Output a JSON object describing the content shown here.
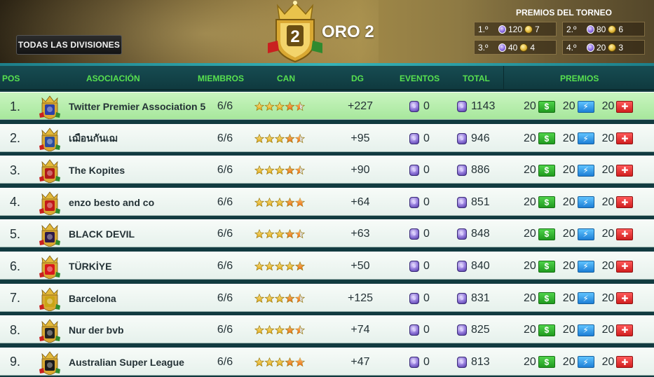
{
  "header": {
    "all_divisions_button": "TODAS LAS DIVISIONES",
    "division_badge_number": "2",
    "division_title": "ORO 2",
    "prizes_title": "PREMIOS DEL TORNEO",
    "prizes": [
      {
        "place": "1.º",
        "gems": "120",
        "coins": "7"
      },
      {
        "place": "2.º",
        "gems": "80",
        "coins": "6"
      },
      {
        "place": "3.º",
        "gems": "40",
        "coins": "4"
      },
      {
        "place": "4.º",
        "gems": "20",
        "coins": "3"
      }
    ]
  },
  "columns": {
    "pos": "POS",
    "association": "ASOCIACIÓN",
    "members": "MIEMBROS",
    "can": "CAN",
    "dg": "DG",
    "events": "EVENTOS",
    "total": "TOTAL",
    "prizes": "PREMIOS"
  },
  "rows": [
    {
      "pos": "1.",
      "name": "Twitter Premier Association 5",
      "members": "6/6",
      "stars": 4.5,
      "dg": "+227",
      "events": "0",
      "total": "1143",
      "p1": "20",
      "p2": "20",
      "p3": "20",
      "crest_color": "#2b3fa8",
      "highlight": true
    },
    {
      "pos": "2.",
      "name": "เฌือนกันเฌ",
      "members": "6/6",
      "stars": 4.5,
      "dg": "+95",
      "events": "0",
      "total": "946",
      "p1": "20",
      "p2": "20",
      "p3": "20",
      "crest_color": "#2c4d9e",
      "highlight": false
    },
    {
      "pos": "3.",
      "name": "The Kopites",
      "members": "6/6",
      "stars": 4.5,
      "dg": "+90",
      "events": "0",
      "total": "886",
      "p1": "20",
      "p2": "20",
      "p3": "20",
      "crest_color": "#b01919",
      "highlight": false
    },
    {
      "pos": "4.",
      "name": "enzo besto and co",
      "members": "6/6",
      "stars": 4.75,
      "dg": "+64",
      "events": "0",
      "total": "851",
      "p1": "20",
      "p2": "20",
      "p3": "20",
      "crest_color": "#c21a1a",
      "highlight": false
    },
    {
      "pos": "5.",
      "name": "BLACK DEVIL",
      "members": "6/6",
      "stars": 4.5,
      "dg": "+63",
      "events": "0",
      "total": "848",
      "p1": "20",
      "p2": "20",
      "p3": "20",
      "crest_color": "#2d1a4a",
      "highlight": false
    },
    {
      "pos": "6.",
      "name": "TÜRKİYE",
      "members": "6/6",
      "stars": 5,
      "dg": "+50",
      "events": "0",
      "total": "840",
      "p1": "20",
      "p2": "20",
      "p3": "20",
      "crest_color": "#d8161c",
      "highlight": false
    },
    {
      "pos": "7.",
      "name": "Barcelona",
      "members": "6/6",
      "stars": 4.5,
      "dg": "+125",
      "events": "0",
      "total": "831",
      "p1": "20",
      "p2": "20",
      "p3": "20",
      "crest_color": "#c9a516",
      "highlight": false
    },
    {
      "pos": "8.",
      "name": "Nur der bvb",
      "members": "6/6",
      "stars": 4.5,
      "dg": "+74",
      "events": "0",
      "total": "825",
      "p1": "20",
      "p2": "20",
      "p3": "20",
      "crest_color": "#222222",
      "highlight": false
    },
    {
      "pos": "9.",
      "name": "Australian Super League",
      "members": "6/6",
      "stars": 4.75,
      "dg": "+47",
      "events": "0",
      "total": "813",
      "p1": "20",
      "p2": "20",
      "p3": "20",
      "crest_color": "#1a1a1a",
      "highlight": false
    }
  ],
  "icons": {
    "gem": "gem-icon",
    "coin": "coin-icon",
    "prize1": "green-cash-icon",
    "prize2": "blue-energy-icon",
    "prize3": "red-medical-icon"
  }
}
